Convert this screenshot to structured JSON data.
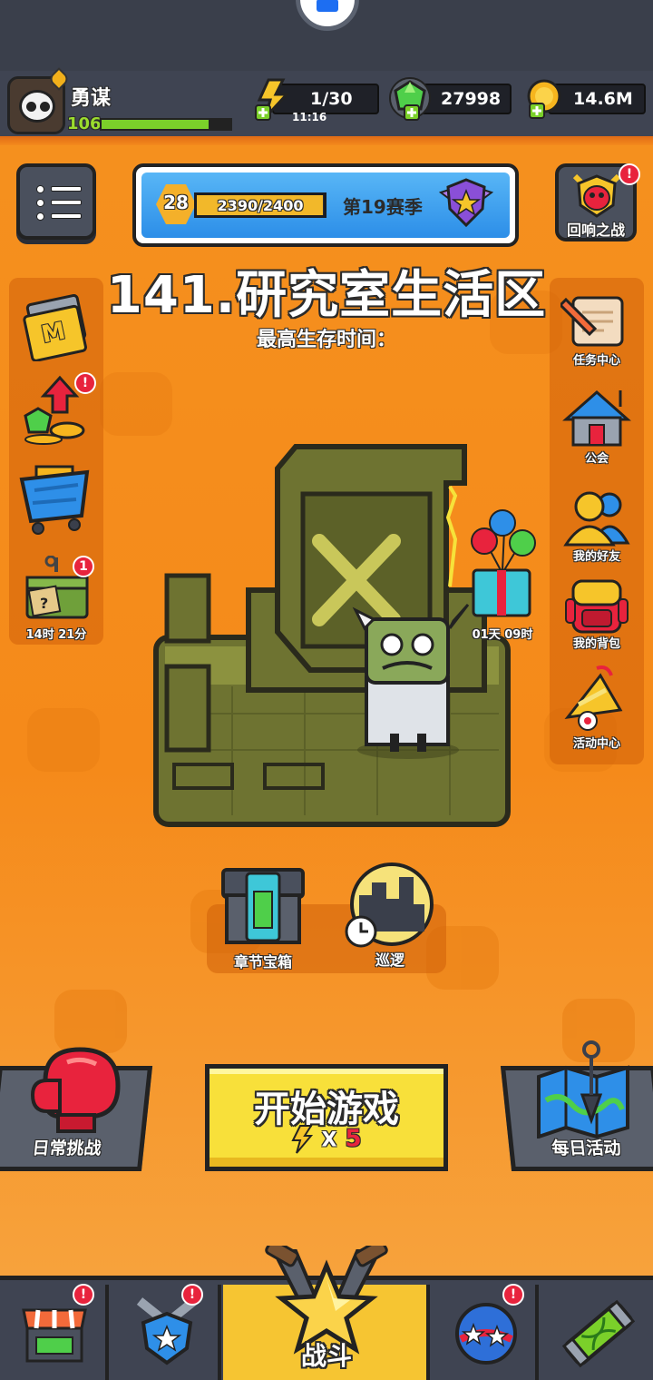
{
  "player": {
    "name": "勇谋",
    "level": "106",
    "xp_fraction": 0.83
  },
  "resources": {
    "energy": "1/30",
    "energy_timer": "11:16",
    "gems": "27998",
    "gold": "14.6M"
  },
  "season": {
    "level": "28",
    "progress_text": "2390/2400",
    "progress_fraction": 0.996,
    "label": "第19赛季"
  },
  "echo_battle": {
    "label": "回响之战",
    "badge": "!"
  },
  "stage": {
    "title": "141.研究室生活区",
    "subtitle": "最高生存时间："
  },
  "left_sidebar": {
    "m_card": {
      "label": "M"
    },
    "gem_upgrade": {
      "badge": "!"
    },
    "shop_cart": {},
    "supply_crate": {
      "badge": "1",
      "timer": "14时 21分"
    }
  },
  "right_sidebar": {
    "tasks": {
      "label": "任务中心"
    },
    "guild": {
      "label": "公会"
    },
    "friends": {
      "label": "我的好友"
    },
    "backpack": {
      "label": "我的背包"
    },
    "events": {
      "label": "活动中心"
    }
  },
  "gift_timer": "01天 09时",
  "stage_buttons": {
    "chest": "章节宝箱",
    "patrol": "巡逻"
  },
  "start": {
    "label": "开始游戏",
    "cost_prefix": "X",
    "cost_value": "5"
  },
  "daily_challenge": "日常挑战",
  "daily_activity": "每日活动",
  "nav": {
    "battle": "战斗",
    "badges": [
      "!",
      "!",
      "!"
    ]
  },
  "colors": {
    "background": "#f48a1c",
    "topbar": "#3f4452",
    "start_button": "#f8e03a",
    "badge": "#e8233d"
  }
}
